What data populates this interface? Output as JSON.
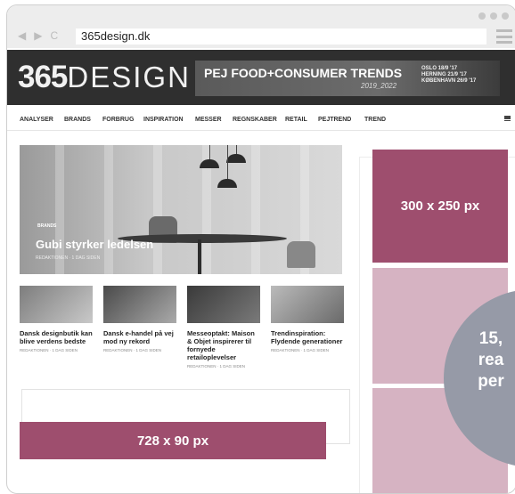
{
  "browser": {
    "url": "365design.dk"
  },
  "site": {
    "logo_bold": "365",
    "logo_thin": "DESIGN",
    "banner": {
      "title": "PEJ FOOD+CONSUMER TRENDS",
      "subtitle": "2019_2022",
      "dates": [
        "OSLO 18/9 '17",
        "HERNING 21/9 '17",
        "KØBENHAVN 26/9 '17"
      ]
    },
    "nav": [
      "ANALYSER",
      "BRANDS",
      "FORBRUG",
      "INSPIRATION",
      "MESSER",
      "REGNSKABER",
      "RETAIL",
      "PEJTREND",
      "TREND"
    ]
  },
  "hero": {
    "category": "BRANDS",
    "title": "Gubi styrker ledelsen",
    "meta": "REDAKTIONEN · 1 DAG SIDEN"
  },
  "articles": [
    {
      "title": "Dansk designbutik kan blive verdens bedste",
      "meta": "REDAKTIONEN · 1 DAG SIDEN"
    },
    {
      "title": "Dansk e-handel på vej mod ny rekord",
      "meta": "REDAKTIONEN · 1 DAG SIDEN"
    },
    {
      "title": "Messeoptakt: Maison & Objet inspirerer til fornyede retailoplevelser",
      "meta": "REDAKTIONEN · 1 DAG SIDEN"
    },
    {
      "title": "Trendinspiration: Flydende generationer",
      "meta": "REDAKTIONEN · 1 DAG SIDEN"
    }
  ],
  "ads": {
    "leaderboard": "728 x 90 px",
    "rectangle": "300 x 250 px",
    "circle_lines": [
      "15,",
      "rea",
      "per"
    ]
  },
  "colors": {
    "ad_primary": "#9e4e6e",
    "ad_light": "#d6b3c2",
    "circle": "#969aa7",
    "header_bg": "#2f2f2f"
  }
}
